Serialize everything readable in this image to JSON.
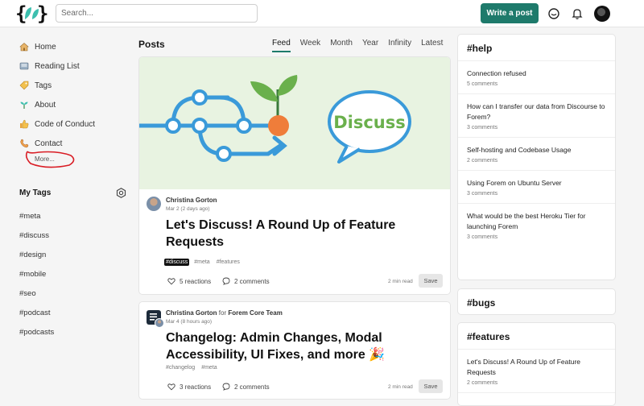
{
  "header": {
    "search_placeholder": "Search...",
    "write_label": "Write a post"
  },
  "nav": {
    "items": [
      {
        "label": "Home",
        "icon": "house-icon"
      },
      {
        "label": "Reading List",
        "icon": "reading-list-icon"
      },
      {
        "label": "Tags",
        "icon": "tag-icon"
      },
      {
        "label": "About",
        "icon": "sprout-icon"
      },
      {
        "label": "Code of Conduct",
        "icon": "thumbs-up-icon"
      },
      {
        "label": "Contact",
        "icon": "contact-icon"
      }
    ],
    "more_label": "More..."
  },
  "my_tags": {
    "title": "My Tags",
    "tags": [
      "#meta",
      "#discuss",
      "#design",
      "#mobile",
      "#seo",
      "#podcast",
      "#podcasts"
    ]
  },
  "feed": {
    "title": "Posts",
    "tabs": [
      "Feed",
      "Week",
      "Month",
      "Year",
      "Infinity",
      "Latest"
    ],
    "active_tab": "Feed",
    "posts": [
      {
        "cover_text": "Discuss",
        "author": "Christina Gorton",
        "date": "Mar 2 (2 days ago)",
        "title": "Let's Discuss! A Round Up of Feature Requests",
        "tags": [
          "#discuss",
          "#meta",
          "#features"
        ],
        "reactions": "5 reactions",
        "comments": "2 comments",
        "read_time": "2 min read",
        "save_label": "Save"
      },
      {
        "author": "Christina Gorton",
        "team_prefix": "for",
        "team": "Forem Core Team",
        "date": "Mar 4 (8 hours ago)",
        "title": "Changelog: Admin Changes, Modal Accessibility, UI Fixes, and more 🎉",
        "tags": [
          "#changelog",
          "#meta"
        ],
        "reactions": "3 reactions",
        "comments": "2 comments",
        "read_time": "2 min read",
        "save_label": "Save"
      }
    ]
  },
  "right": {
    "help": {
      "title": "#help",
      "items": [
        {
          "title": "Connection refused",
          "count": "5 comments"
        },
        {
          "title": "How can I transfer our data from Discourse to Forem?",
          "count": "3 comments"
        },
        {
          "title": "Self-hosting and Codebase Usage",
          "count": "2 comments"
        },
        {
          "title": "Using Forem on Ubuntu Server",
          "count": "3 comments"
        },
        {
          "title": "What would be the best Heroku Tier for launching Forem",
          "count": "3 comments"
        }
      ]
    },
    "bugs": {
      "title": "#bugs"
    },
    "features": {
      "title": "#features",
      "items": [
        {
          "title": "Let's Discuss! A Round Up of Feature Requests",
          "count": "2 comments"
        }
      ]
    }
  },
  "colors": {
    "accent": "#1e7a6b",
    "cover_bg": "#e8f3e1",
    "annotation": "#d91c24"
  }
}
